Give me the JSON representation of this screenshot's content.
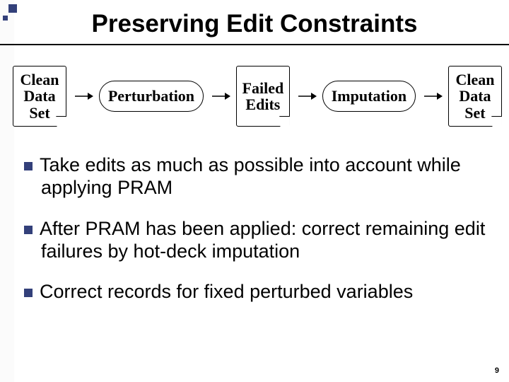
{
  "title": "Preserving Edit Constraints",
  "flow": {
    "n1_l1": "Clean",
    "n1_l2": "Data",
    "n1_l3": "Set",
    "n2": "Perturbation",
    "n3_l1": "Failed",
    "n3_l2": "Edits",
    "n4": "Imputation",
    "n5_l1": "Clean",
    "n5_l2": "Data",
    "n5_l3": "Set"
  },
  "bullets": {
    "b1": "Take edits as much as possible into account while applying PRAM",
    "b2": "After PRAM has been applied: correct remaining edit failures by hot-deck imputation",
    "b3": "Correct records for fixed perturbed variables"
  },
  "pagenum": "9"
}
